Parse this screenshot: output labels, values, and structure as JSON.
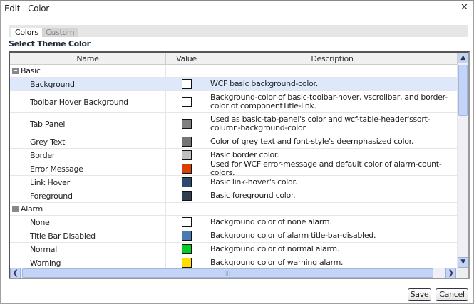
{
  "window": {
    "title": "Edit - Color",
    "close_glyph": "✕"
  },
  "tabs": [
    {
      "label": "Colors",
      "active": true
    },
    {
      "label": "Custom",
      "active": false
    }
  ],
  "section_title": "Select Theme Color",
  "columns": [
    "Name",
    "Value",
    "Description"
  ],
  "groups": [
    {
      "label": "Basic",
      "items": [
        {
          "name": "Background",
          "color": "#ffffff",
          "description": "WCF basic background-color.",
          "selected": true
        },
        {
          "name": "Toolbar Hover Background",
          "color": "#ffffff",
          "description": "Background-color of basic-toolbar-hover, vscrollbar, and border-color of componentTitle-link."
        },
        {
          "name": "Tab Panel",
          "color": "#808080",
          "description": "Used as basic-tab-panel's color and wcf-table-header'ssort-column-background-color."
        },
        {
          "name": "Grey Text",
          "color": "#757575",
          "description": "Color of grey text and font-style's deemphasized color."
        },
        {
          "name": "Border",
          "color": "#c0c0c0",
          "description": "Basic border color."
        },
        {
          "name": "Error Message",
          "color": "#d84000",
          "description": "Used for WCF error-message and default color of alarm-count-colors."
        },
        {
          "name": "Link Hover",
          "color": "#2c4a6e",
          "description": "Basic link-hover's color."
        },
        {
          "name": "Foreground",
          "color": "#333d50",
          "description": "Basic foreground color."
        }
      ]
    },
    {
      "label": "Alarm",
      "items": [
        {
          "name": "None",
          "color": "#ffffff",
          "description": "Background color of none alarm."
        },
        {
          "name": "Title Bar Disabled",
          "color": "#4a7ab0",
          "description": "Background color of alarm title-bar-disabled."
        },
        {
          "name": "Normal",
          "color": "#00cc22",
          "description": "Background color of normal alarm."
        },
        {
          "name": "Warning",
          "color": "#ffdd00",
          "description": "Background color of warning alarm."
        }
      ]
    }
  ],
  "buttons": {
    "save": "Save",
    "cancel": "Cancel"
  }
}
